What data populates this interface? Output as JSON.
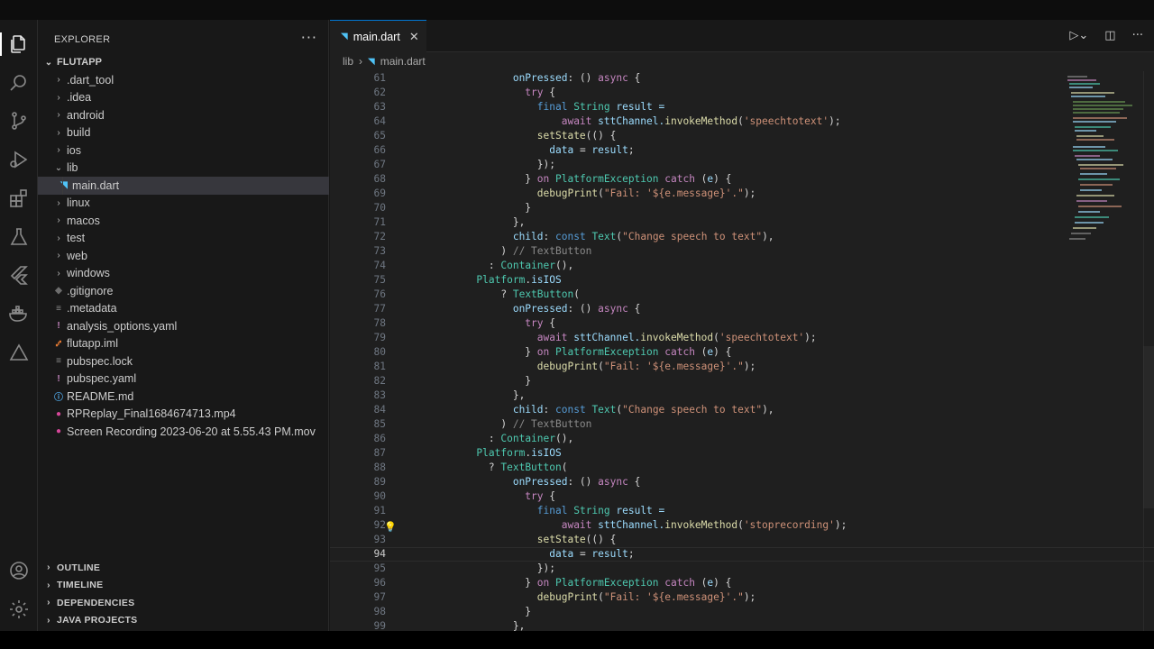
{
  "sidebar": {
    "header": "EXPLORER",
    "more": "···",
    "root": "FLUTAPP",
    "items": [
      {
        "label": ".dart_tool",
        "chev": "›",
        "icon": "",
        "color": "#cccccc"
      },
      {
        "label": ".idea",
        "chev": "›",
        "icon": "",
        "color": "#cccccc"
      },
      {
        "label": "android",
        "chev": "›",
        "icon": "",
        "color": "#cccccc"
      },
      {
        "label": "build",
        "chev": "›",
        "icon": "",
        "color": "#cccccc"
      },
      {
        "label": "ios",
        "chev": "›",
        "icon": "",
        "color": "#cccccc"
      },
      {
        "label": "lib",
        "chev": "⌄",
        "icon": "",
        "color": "#cccccc"
      },
      {
        "label": "main.dart",
        "chev": "",
        "icon": "◥",
        "color": "#4fc3f7"
      },
      {
        "label": "linux",
        "chev": "›",
        "icon": "",
        "color": "#cccccc"
      },
      {
        "label": "macos",
        "chev": "›",
        "icon": "",
        "color": "#cccccc"
      },
      {
        "label": "test",
        "chev": "›",
        "icon": "",
        "color": "#cccccc"
      },
      {
        "label": "web",
        "chev": "›",
        "icon": "",
        "color": "#cccccc"
      },
      {
        "label": "windows",
        "chev": "›",
        "icon": "",
        "color": "#cccccc"
      },
      {
        "label": ".gitignore",
        "chev": "",
        "icon": "◆",
        "color": "#6d6d6d"
      },
      {
        "label": ".metadata",
        "chev": "",
        "icon": "≡",
        "color": "#8a8a8a"
      },
      {
        "label": "analysis_options.yaml",
        "chev": "",
        "icon": "!",
        "color": "#c586c0"
      },
      {
        "label": "flutapp.iml",
        "chev": "",
        "icon": "⑇",
        "color": "#e37933"
      },
      {
        "label": "pubspec.lock",
        "chev": "",
        "icon": "≡",
        "color": "#8a8a8a"
      },
      {
        "label": "pubspec.yaml",
        "chev": "",
        "icon": "!",
        "color": "#c586c0"
      },
      {
        "label": "README.md",
        "chev": "",
        "icon": "ⓘ",
        "color": "#4fa3e0"
      },
      {
        "label": "RPReplay_Final1684674713.mp4",
        "chev": "",
        "icon": "●",
        "color": "#d6479a"
      },
      {
        "label": "Screen Recording 2023-06-20 at 5.55.43 PM.mov",
        "chev": "",
        "icon": "●",
        "color": "#d6479a"
      }
    ],
    "sections": [
      "OUTLINE",
      "TIMELINE",
      "DEPENDENCIES",
      "JAVA PROJECTS"
    ]
  },
  "editor": {
    "tab_label": "main.dart",
    "breadcrumb": [
      "lib",
      "main.dart"
    ],
    "current_line": 94,
    "lines": [
      {
        "n": "61",
        "code": [
          [
            "            ",
            ""
          ],
          [
            "onPressed",
            "v"
          ],
          [
            ": () ",
            "p"
          ],
          [
            "async",
            "k"
          ],
          [
            " {",
            "p"
          ]
        ]
      },
      {
        "n": "62",
        "code": [
          [
            "              ",
            ""
          ],
          [
            "try",
            "k"
          ],
          [
            " {",
            "p"
          ]
        ]
      },
      {
        "n": "63",
        "code": [
          [
            "                ",
            ""
          ],
          [
            "final",
            "b"
          ],
          [
            " ",
            ""
          ],
          [
            "String",
            "t"
          ],
          [
            " result =",
            "v"
          ]
        ]
      },
      {
        "n": "64",
        "code": [
          [
            "                    ",
            ""
          ],
          [
            "await",
            "k"
          ],
          [
            " sttChannel.",
            "v"
          ],
          [
            "invokeMethod",
            "f"
          ],
          [
            "(",
            "p"
          ],
          [
            "'speechtotext'",
            "s"
          ],
          [
            ");",
            "p"
          ]
        ]
      },
      {
        "n": "65",
        "code": [
          [
            "                ",
            ""
          ],
          [
            "setState",
            "f"
          ],
          [
            "(() {",
            "p"
          ]
        ]
      },
      {
        "n": "66",
        "code": [
          [
            "                  ",
            ""
          ],
          [
            "data",
            "v"
          ],
          [
            " = ",
            "p"
          ],
          [
            "result",
            "v"
          ],
          [
            ";",
            "p"
          ]
        ]
      },
      {
        "n": "67",
        "code": [
          [
            "                ",
            ""
          ],
          [
            "});",
            "p"
          ]
        ]
      },
      {
        "n": "68",
        "code": [
          [
            "              ",
            ""
          ],
          [
            "}",
            "p"
          ],
          [
            " on ",
            "k"
          ],
          [
            "PlatformException",
            "t"
          ],
          [
            " catch ",
            "k"
          ],
          [
            "(",
            "p"
          ],
          [
            "e",
            "v"
          ],
          [
            ") {",
            "p"
          ]
        ]
      },
      {
        "n": "69",
        "code": [
          [
            "                ",
            ""
          ],
          [
            "debugPrint",
            "f"
          ],
          [
            "(",
            "p"
          ],
          [
            "\"Fail: '${e.message}'.\"",
            "s"
          ],
          [
            ");",
            "p"
          ]
        ]
      },
      {
        "n": "70",
        "code": [
          [
            "              ",
            ""
          ],
          [
            "}",
            "p"
          ]
        ]
      },
      {
        "n": "71",
        "code": [
          [
            "            ",
            ""
          ],
          [
            "},",
            "p"
          ]
        ]
      },
      {
        "n": "72",
        "code": [
          [
            "            ",
            ""
          ],
          [
            "child",
            "v"
          ],
          [
            ": ",
            "p"
          ],
          [
            "const",
            "b"
          ],
          [
            " ",
            ""
          ],
          [
            "Text",
            "t"
          ],
          [
            "(",
            "p"
          ],
          [
            "\"Change speech to text\"",
            "s"
          ],
          [
            "),",
            "p"
          ]
        ]
      },
      {
        "n": "73",
        "code": [
          [
            "          ",
            ""
          ],
          [
            ") ",
            "p"
          ],
          [
            "// TextButton",
            "cm"
          ]
        ]
      },
      {
        "n": "74",
        "code": [
          [
            "        ",
            ""
          ],
          [
            ": ",
            "p"
          ],
          [
            "Container",
            "t"
          ],
          [
            "(),",
            "p"
          ]
        ]
      },
      {
        "n": "75",
        "code": [
          [
            "      ",
            ""
          ],
          [
            "Platform",
            "t"
          ],
          [
            ".",
            "p"
          ],
          [
            "isIOS",
            "v"
          ]
        ]
      },
      {
        "n": "76",
        "code": [
          [
            "          ",
            ""
          ],
          [
            "? ",
            "p"
          ],
          [
            "TextButton",
            "t"
          ],
          [
            "(",
            "p"
          ]
        ]
      },
      {
        "n": "77",
        "code": [
          [
            "            ",
            ""
          ],
          [
            "onPressed",
            "v"
          ],
          [
            ": () ",
            "p"
          ],
          [
            "async",
            "k"
          ],
          [
            " {",
            "p"
          ]
        ]
      },
      {
        "n": "78",
        "code": [
          [
            "              ",
            ""
          ],
          [
            "try",
            "k"
          ],
          [
            " {",
            "p"
          ]
        ]
      },
      {
        "n": "79",
        "code": [
          [
            "                ",
            ""
          ],
          [
            "await",
            "k"
          ],
          [
            " sttChannel.",
            "v"
          ],
          [
            "invokeMethod",
            "f"
          ],
          [
            "(",
            "p"
          ],
          [
            "'speechtotext'",
            "s"
          ],
          [
            ");",
            "p"
          ]
        ]
      },
      {
        "n": "80",
        "code": [
          [
            "              ",
            ""
          ],
          [
            "}",
            "p"
          ],
          [
            " on ",
            "k"
          ],
          [
            "PlatformException",
            "t"
          ],
          [
            " catch ",
            "k"
          ],
          [
            "(",
            "p"
          ],
          [
            "e",
            "v"
          ],
          [
            ") {",
            "p"
          ]
        ]
      },
      {
        "n": "81",
        "code": [
          [
            "                ",
            ""
          ],
          [
            "debugPrint",
            "f"
          ],
          [
            "(",
            "p"
          ],
          [
            "\"Fail: '${e.message}'.\"",
            "s"
          ],
          [
            ");",
            "p"
          ]
        ]
      },
      {
        "n": "82",
        "code": [
          [
            "              ",
            ""
          ],
          [
            "}",
            "p"
          ]
        ]
      },
      {
        "n": "83",
        "code": [
          [
            "            ",
            ""
          ],
          [
            "},",
            "p"
          ]
        ]
      },
      {
        "n": "84",
        "code": [
          [
            "            ",
            ""
          ],
          [
            "child",
            "v"
          ],
          [
            ": ",
            "p"
          ],
          [
            "const",
            "b"
          ],
          [
            " ",
            ""
          ],
          [
            "Text",
            "t"
          ],
          [
            "(",
            "p"
          ],
          [
            "\"Change speech to text\"",
            "s"
          ],
          [
            "),",
            "p"
          ]
        ]
      },
      {
        "n": "85",
        "code": [
          [
            "          ",
            ""
          ],
          [
            ") ",
            "p"
          ],
          [
            "// TextButton",
            "cm"
          ]
        ]
      },
      {
        "n": "86",
        "code": [
          [
            "        ",
            ""
          ],
          [
            ": ",
            "p"
          ],
          [
            "Container",
            "t"
          ],
          [
            "(),",
            "p"
          ]
        ]
      },
      {
        "n": "87",
        "code": [
          [
            "      ",
            ""
          ],
          [
            "Platform",
            "t"
          ],
          [
            ".",
            "p"
          ],
          [
            "isIOS",
            "v"
          ]
        ]
      },
      {
        "n": "88",
        "code": [
          [
            "        ",
            ""
          ],
          [
            "? ",
            "p"
          ],
          [
            "TextButton",
            "t"
          ],
          [
            "(",
            "p"
          ]
        ]
      },
      {
        "n": "89",
        "code": [
          [
            "            ",
            ""
          ],
          [
            "onPressed",
            "v"
          ],
          [
            ": () ",
            "p"
          ],
          [
            "async",
            "k"
          ],
          [
            " {",
            "p"
          ]
        ]
      },
      {
        "n": "90",
        "code": [
          [
            "              ",
            ""
          ],
          [
            "try",
            "k"
          ],
          [
            " {",
            "p"
          ]
        ]
      },
      {
        "n": "91",
        "code": [
          [
            "                ",
            ""
          ],
          [
            "final",
            "b"
          ],
          [
            " ",
            ""
          ],
          [
            "String",
            "t"
          ],
          [
            " result =",
            "v"
          ]
        ]
      },
      {
        "n": "92",
        "code": [
          [
            "                    ",
            ""
          ],
          [
            "await",
            "k"
          ],
          [
            " sttChannel.",
            "v"
          ],
          [
            "invokeMethod",
            "f"
          ],
          [
            "(",
            "p"
          ],
          [
            "'stoprecording'",
            "s"
          ],
          [
            ");",
            "p"
          ]
        ]
      },
      {
        "n": "93",
        "code": [
          [
            "                ",
            ""
          ],
          [
            "setState",
            "f"
          ],
          [
            "(() {",
            "p"
          ]
        ]
      },
      {
        "n": "94",
        "code": [
          [
            "                  ",
            ""
          ],
          [
            "data",
            "v"
          ],
          [
            " = ",
            "p"
          ],
          [
            "result",
            "v"
          ],
          [
            ";",
            "p"
          ]
        ]
      },
      {
        "n": "95",
        "code": [
          [
            "                ",
            ""
          ],
          [
            "});",
            "p"
          ]
        ]
      },
      {
        "n": "96",
        "code": [
          [
            "              ",
            ""
          ],
          [
            "}",
            "p"
          ],
          [
            " on ",
            "k"
          ],
          [
            "PlatformException",
            "t"
          ],
          [
            " catch ",
            "k"
          ],
          [
            "(",
            "p"
          ],
          [
            "e",
            "v"
          ],
          [
            ") {",
            "p"
          ]
        ]
      },
      {
        "n": "97",
        "code": [
          [
            "                ",
            ""
          ],
          [
            "debugPrint",
            "f"
          ],
          [
            "(",
            "p"
          ],
          [
            "\"Fail: '${e.message}'.\"",
            "s"
          ],
          [
            ");",
            "p"
          ]
        ]
      },
      {
        "n": "98",
        "code": [
          [
            "              ",
            ""
          ],
          [
            "}",
            "p"
          ]
        ]
      },
      {
        "n": "99",
        "code": [
          [
            "            ",
            ""
          ],
          [
            "},",
            "p"
          ]
        ]
      }
    ],
    "lightbulb_line": 92
  },
  "icons": {
    "activity": [
      "files-icon",
      "search-icon",
      "source-control-icon",
      "run-debug-icon",
      "extensions-icon",
      "testing-icon",
      "flutter-icon",
      "docker-icon",
      "triangle-icon"
    ],
    "bottom": [
      "account-icon",
      "settings-gear-icon"
    ]
  },
  "colors": {
    "accent": "#0078d4",
    "dart": "#4fc3f7"
  }
}
